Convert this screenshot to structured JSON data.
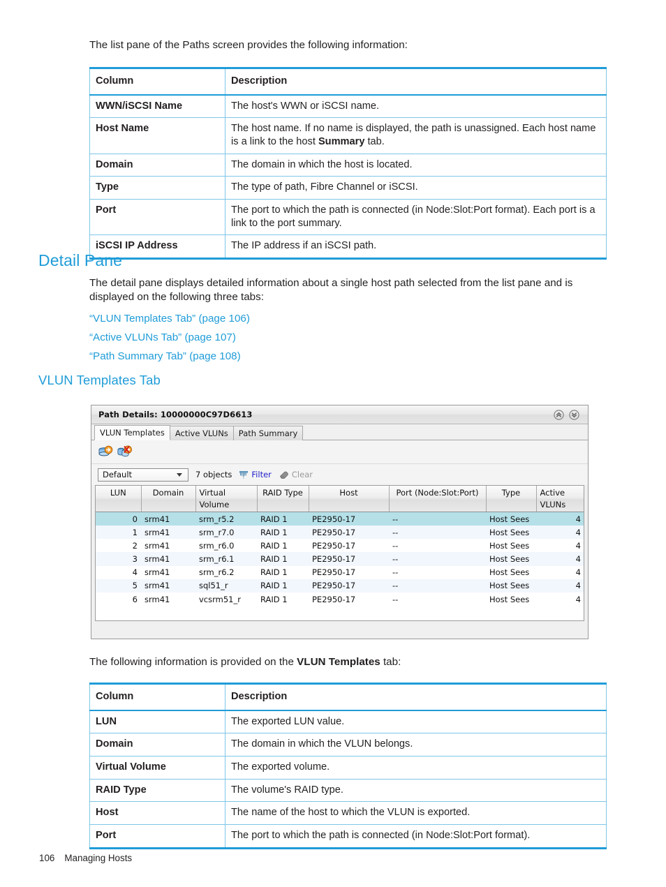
{
  "intro": {
    "paragraph": "The list pane of the Paths screen provides the following information:"
  },
  "paths_table": {
    "headers": {
      "column": "Column",
      "description": "Description"
    },
    "rows": [
      {
        "column": "WWN/iSCSI Name",
        "description": "The host's WWN or iSCSI name."
      },
      {
        "column": "Host Name",
        "description_pre": "The host name. If no name is displayed, the path is unassigned. Each host name is a link to the host ",
        "description_bold": "Summary",
        "description_post": " tab."
      },
      {
        "column": "Domain",
        "description": "The domain in which the host is located."
      },
      {
        "column": "Type",
        "description": "The type of path, Fibre Channel or iSCSI."
      },
      {
        "column": "Port",
        "description": "The port to which the path is connected (in Node:Slot:Port format). Each port is a link to the port summary."
      },
      {
        "column": "iSCSI IP Address",
        "description": "The IP address if an iSCSI path."
      }
    ]
  },
  "detail_pane": {
    "heading": "Detail Pane",
    "paragraph": "The detail pane displays detailed information about a single host path selected from the list pane and is displayed on the following three tabs:",
    "links": [
      "“VLUN Templates Tab” (page 106)",
      "“Active VLUNs Tab” (page 107)",
      "“Path Summary Tab” (page 108)"
    ]
  },
  "vlun_templates_section": {
    "heading": "VLUN Templates Tab",
    "caption_pre": "The following information is provided on the ",
    "caption_bold": "VLUN Templates",
    "caption_post": " tab:"
  },
  "app": {
    "title": "Path Details: 10000000C97D6613",
    "title_buttons": [
      {
        "name": "collapse-all-icon",
        "glyph": "chevron-double-up"
      },
      {
        "name": "expand-all-icon",
        "glyph": "chevron-double-down"
      }
    ],
    "tabs": [
      {
        "label": "VLUN Templates",
        "active": true
      },
      {
        "label": "Active VLUNs",
        "active": false
      },
      {
        "label": "Path Summary",
        "active": false
      }
    ],
    "toolbar_icons": [
      {
        "name": "export-vlun-icon"
      },
      {
        "name": "unexport-vlun-icon"
      }
    ],
    "filter_bar": {
      "view_select_value": "Default",
      "object_count": "7 objects",
      "filter_label": "Filter",
      "clear_label": "Clear"
    },
    "grid": {
      "columns": [
        "LUN",
        "Domain",
        "Virtual Volume",
        "RAID Type",
        "Host",
        "Port (Node:Slot:Port)",
        "Type",
        "Active VLUNs"
      ],
      "rows": [
        {
          "lun": "0",
          "domain": "srm41",
          "virtual_volume": "srm_r5.2",
          "raid_type": "RAID 1",
          "host": "PE2950-17",
          "port": "--",
          "type": "Host Sees",
          "active_vluns": "4"
        },
        {
          "lun": "1",
          "domain": "srm41",
          "virtual_volume": "srm_r7.0",
          "raid_type": "RAID 1",
          "host": "PE2950-17",
          "port": "--",
          "type": "Host Sees",
          "active_vluns": "4"
        },
        {
          "lun": "2",
          "domain": "srm41",
          "virtual_volume": "srm_r6.0",
          "raid_type": "RAID 1",
          "host": "PE2950-17",
          "port": "--",
          "type": "Host Sees",
          "active_vluns": "4"
        },
        {
          "lun": "3",
          "domain": "srm41",
          "virtual_volume": "srm_r6.1",
          "raid_type": "RAID 1",
          "host": "PE2950-17",
          "port": "--",
          "type": "Host Sees",
          "active_vluns": "4"
        },
        {
          "lun": "4",
          "domain": "srm41",
          "virtual_volume": "srm_r6.2",
          "raid_type": "RAID 1",
          "host": "PE2950-17",
          "port": "--",
          "type": "Host Sees",
          "active_vluns": "4"
        },
        {
          "lun": "5",
          "domain": "srm41",
          "virtual_volume": "sql51_r",
          "raid_type": "RAID 1",
          "host": "PE2950-17",
          "port": "--",
          "type": "Host Sees",
          "active_vluns": "4"
        },
        {
          "lun": "6",
          "domain": "srm41",
          "virtual_volume": "vcsrm51_r",
          "raid_type": "RAID 1",
          "host": "PE2950-17",
          "port": "--",
          "type": "Host Sees",
          "active_vluns": "4"
        }
      ]
    }
  },
  "vlun_table": {
    "headers": {
      "column": "Column",
      "description": "Description"
    },
    "rows": [
      {
        "column": "LUN",
        "description": "The exported LUN value."
      },
      {
        "column": "Domain",
        "description": "The domain in which the VLUN belongs."
      },
      {
        "column": "Virtual Volume",
        "description": "The exported volume."
      },
      {
        "column": "RAID Type",
        "description": "The volume's RAID type."
      },
      {
        "column": "Host",
        "description": "The name of the host to which the VLUN is exported."
      },
      {
        "column": "Port",
        "description": "The port to which the path is connected (in Node:Slot:Port format)."
      }
    ]
  },
  "footer": {
    "page_number": "106",
    "chapter": "Managing Hosts"
  },
  "colors": {
    "accent": "#1f9cd8",
    "table_border": "#7ec6e8",
    "grid_selection": "#b5e0e8",
    "grid_link": "#2a2ad0"
  }
}
